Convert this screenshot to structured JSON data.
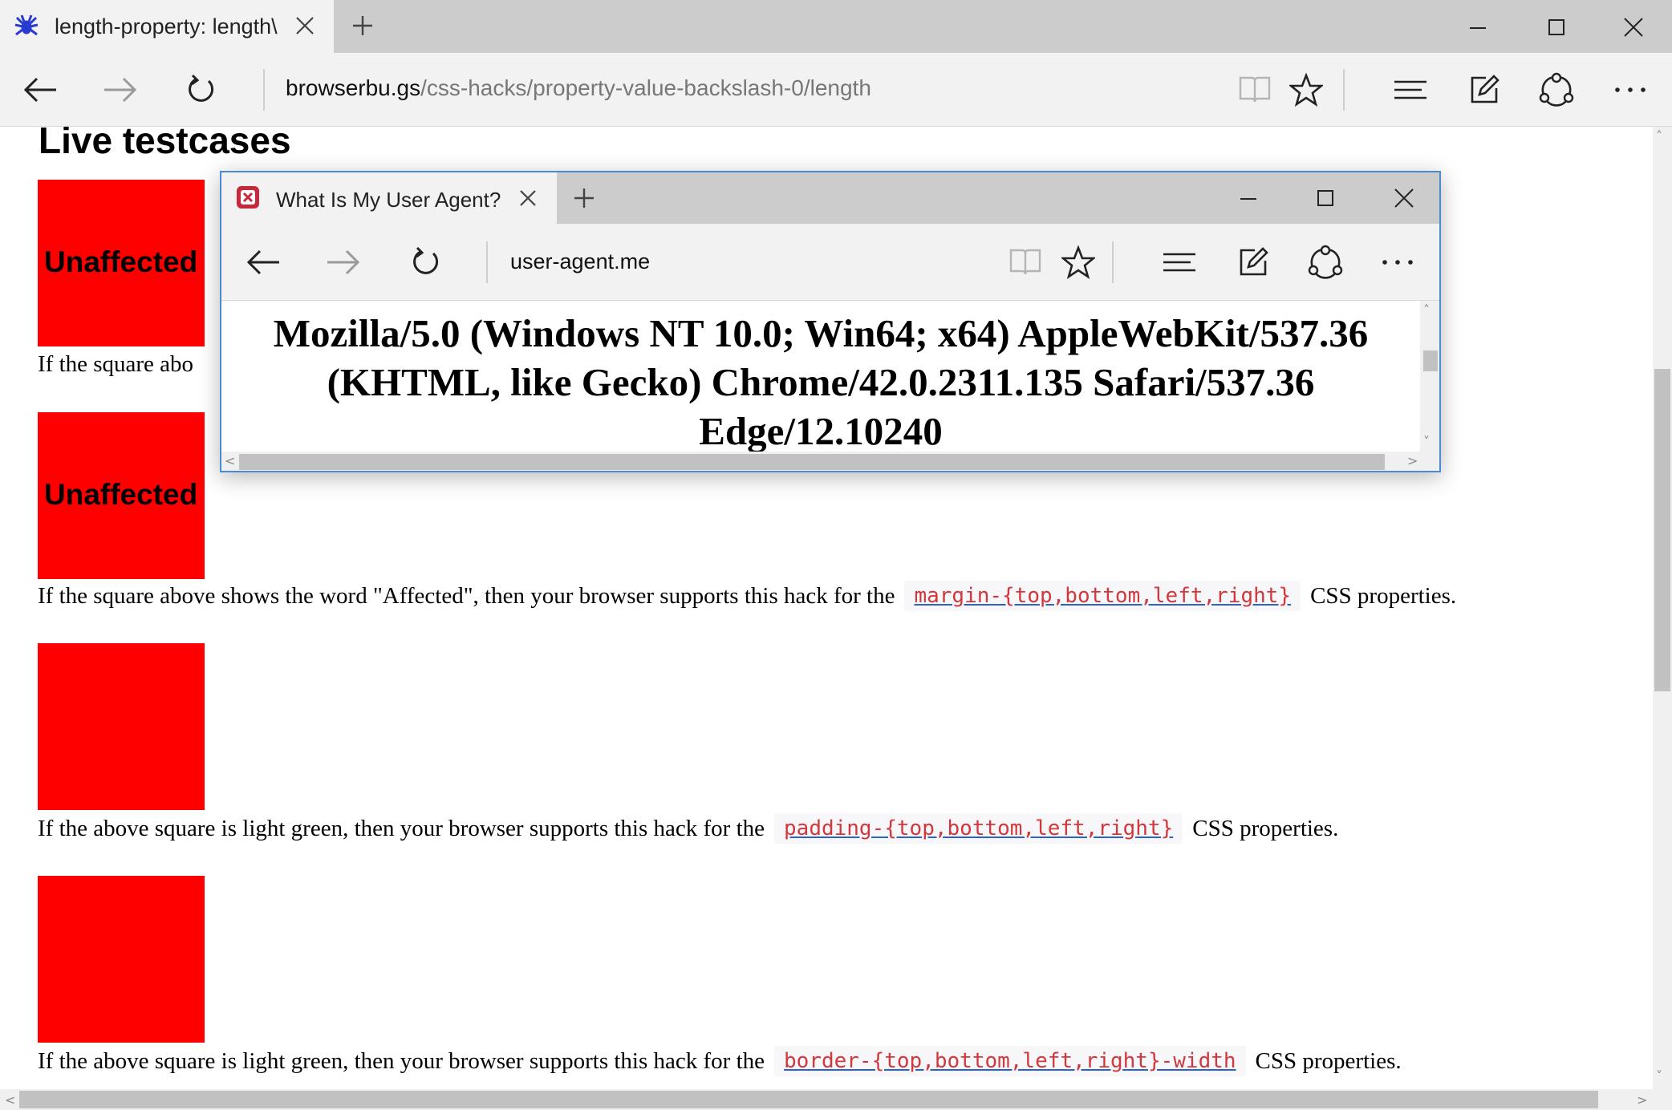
{
  "main_window": {
    "tab": {
      "title": "length-property: length\\",
      "favicon": "spider-icon"
    },
    "url": {
      "domain": "browserbu.gs",
      "path": "/css-hacks/property-value-backslash-0/length"
    }
  },
  "page": {
    "heading": "Live testcases",
    "squares": [
      {
        "label": "Unaffected"
      },
      {
        "label": "Unaffected"
      },
      {
        "label": ""
      },
      {
        "label": ""
      }
    ],
    "lines": [
      {
        "prefix": "If the square abo",
        "code": "",
        "suffix": ""
      },
      {
        "prefix": "If the square above shows the word \"Affected\", then your browser supports this hack for the",
        "code": "margin-{top,bottom,left,right}",
        "suffix": "CSS properties."
      },
      {
        "prefix": "If the above square is light green, then your browser supports this hack for the",
        "code": "padding-{top,bottom,left,right}",
        "suffix": "CSS properties."
      },
      {
        "prefix": "If the above square is light green, then your browser supports this hack for the",
        "code": "border-{top,bottom,left,right}-width",
        "suffix": "CSS properties."
      }
    ]
  },
  "popup_window": {
    "tab": {
      "title": "What Is My User Agent?",
      "favicon": "user-agent-icon"
    },
    "url": "user-agent.me",
    "user_agent": "Mozilla/5.0 (Windows NT 10.0; Win64; x64) AppleWebKit/537.36 (KHTML, like Gecko) Chrome/42.0.2311.135 Safari/537.36 Edge/12.10240"
  },
  "colors": {
    "accent": "#4a8bd4",
    "square": "#ff0000",
    "code_text": "#d1383d"
  }
}
